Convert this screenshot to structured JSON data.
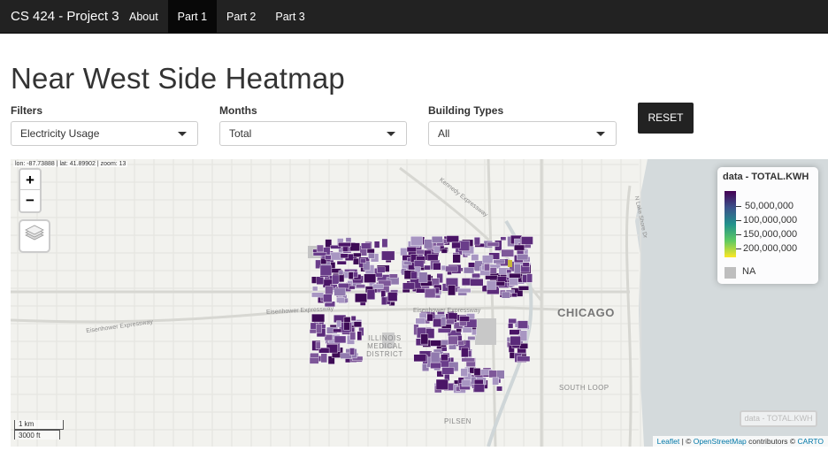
{
  "navbar": {
    "brand": "CS 424 - Project 3",
    "items": [
      {
        "label": "About",
        "active": false
      },
      {
        "label": "Part 1",
        "active": true
      },
      {
        "label": "Part 2",
        "active": false
      },
      {
        "label": "Part 3",
        "active": false
      }
    ]
  },
  "page": {
    "title": "Near West Side Heatmap"
  },
  "filters": {
    "filters_label": "Filters",
    "filters_value": "Electricity Usage",
    "months_label": "Months",
    "months_value": "Total",
    "building_label": "Building Types",
    "building_value": "All",
    "reset_label": "RESET"
  },
  "map": {
    "coords": "lon: -87.73888 | lat: 41.89902 | zoom: 13",
    "zoom_in": "+",
    "zoom_out": "−",
    "labels": {
      "chicago": "CHICAGO",
      "medical": "ILLINOIS MEDICAL DISTRICT",
      "south_loop": "SOUTH LOOP",
      "pilsen": "PILSEN",
      "eisenhower1": "Eisenhower Expressway",
      "eisenhower2": "Eisenhower Expressway",
      "eisenhower3": "Eisenhower Expressway",
      "kennedy": "Kennedy Expressway",
      "lake_shore": "N Lake Shore Dr"
    },
    "legend": {
      "title": "data - TOTAL.KWH",
      "ticks": [
        "50,000,000",
        "100,000,000",
        "150,000,000",
        "200,000,000"
      ],
      "na": "NA",
      "colors": [
        "#440154",
        "#3b528b",
        "#21918c",
        "#5ec962",
        "#fde725"
      ],
      "na_color": "#bebebe"
    },
    "mini_legend": "data - TOTAL.KWH",
    "scale": {
      "km": "1 km",
      "ft": "3000 ft"
    },
    "attribution": {
      "leaflet": "Leaflet",
      "sep1": " | © ",
      "osm": "OpenStreetMap",
      "mid": " contributors © ",
      "carto": "CARTO"
    }
  }
}
